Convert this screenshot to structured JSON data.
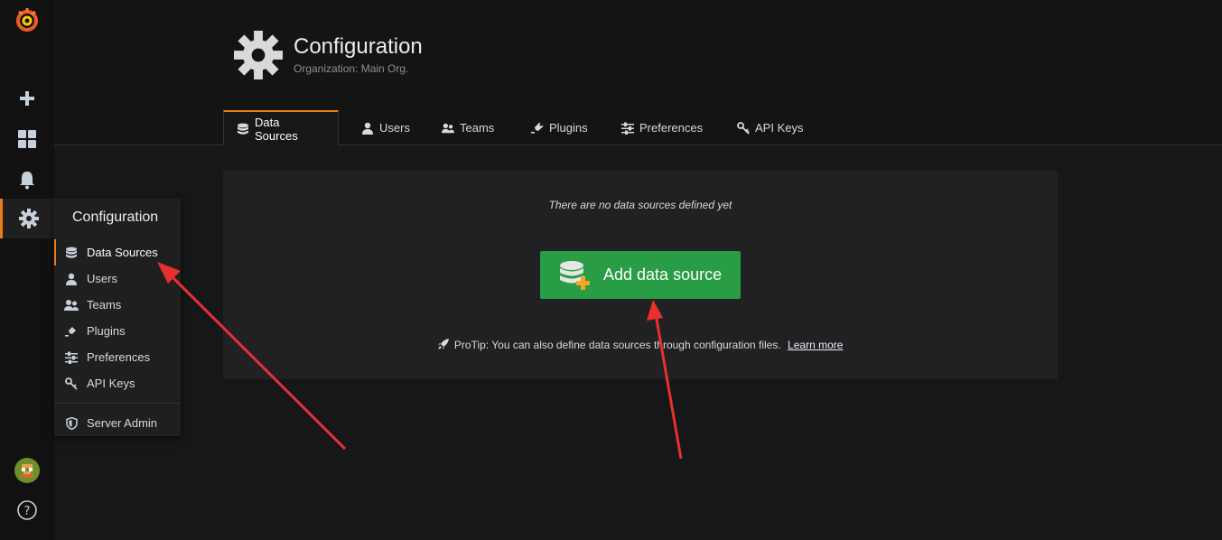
{
  "header": {
    "title": "Configuration",
    "subtitle": "Organization: Main Org."
  },
  "tabs": [
    {
      "label": "Data Sources",
      "icon": "database-icon",
      "active": true
    },
    {
      "label": "Users",
      "icon": "user-icon"
    },
    {
      "label": "Teams",
      "icon": "users-icon"
    },
    {
      "label": "Plugins",
      "icon": "plug-icon"
    },
    {
      "label": "Preferences",
      "icon": "sliders-icon"
    },
    {
      "label": "API Keys",
      "icon": "key-icon"
    }
  ],
  "flyout": {
    "title": "Configuration",
    "items": [
      {
        "label": "Data Sources",
        "icon": "database-icon",
        "active": true
      },
      {
        "label": "Users",
        "icon": "user-icon"
      },
      {
        "label": "Teams",
        "icon": "users-icon"
      },
      {
        "label": "Plugins",
        "icon": "plug-icon"
      },
      {
        "label": "Preferences",
        "icon": "sliders-icon"
      },
      {
        "label": "API Keys",
        "icon": "key-icon"
      }
    ],
    "server_admin": "Server Admin"
  },
  "main": {
    "empty_message": "There are no data sources defined yet",
    "add_button": "Add data source",
    "protip": "ProTip: You can also define data sources through configuration files.",
    "learn_more": "Learn more"
  },
  "colors": {
    "accent": "#eb7b18",
    "button_green": "#299c46",
    "arrow_red": "#e8302f"
  }
}
